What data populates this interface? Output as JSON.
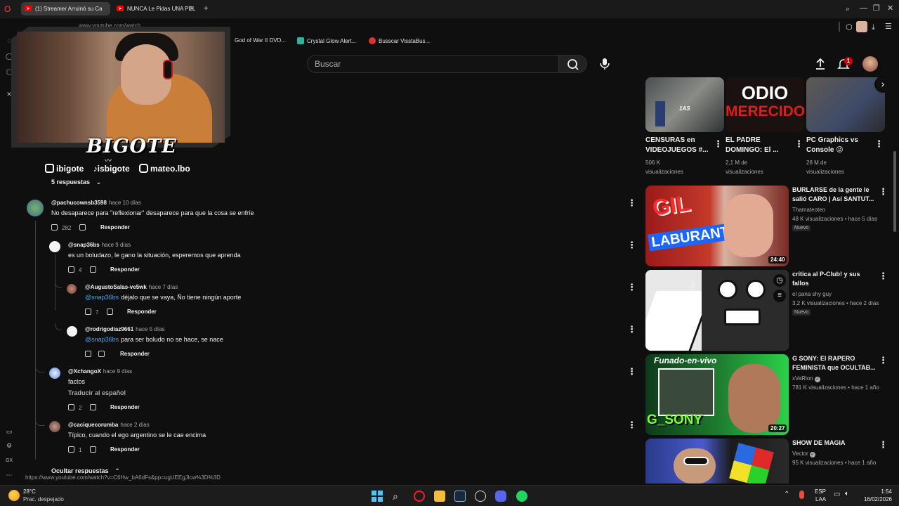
{
  "browser": {
    "tabs": [
      {
        "label": "(1) Streamer Arruinó su Ca",
        "active": true
      },
      {
        "label": "NUNCA Le Pidas UNA PEL",
        "active": false
      }
    ],
    "new_tab": "+",
    "address": "www.youtube.com/watch",
    "bookmarks": [
      {
        "label": "God of War II DVD...",
        "color": "#3a3a3a"
      },
      {
        "label": "Crystal Glow Alert...",
        "color": "#2bb3a3"
      },
      {
        "label": "Busscar VisstaBus...",
        "color": "#e03131"
      }
    ],
    "status_url": "https://www.youtube.com/watch?v=C6Hw_bA6dFs&pp=ugUEEgJlcw%3D%3D"
  },
  "youtube": {
    "search_placeholder": "Buscar",
    "notification_count": "1"
  },
  "overlay": {
    "brand": "BIGOTE",
    "socials": [
      {
        "icon": "twitch-kick-icon",
        "label": "ibigote"
      },
      {
        "icon": "tiktok-icon",
        "label": "isbigote"
      },
      {
        "icon": "instagram-icon",
        "label": "mateo.lbo"
      }
    ]
  },
  "comments": {
    "replies_toggle": "5 respuestas",
    "hide_replies": "Ocultar respuestas",
    "reply_label": "Responder",
    "translate_label": "Traducir al español",
    "items": [
      {
        "handle": "@pachucownsb3598",
        "time": "hace 10 días",
        "text": "No desaparece para \"reflexionar\" desaparece para que la cosa se enfríe",
        "likes": "282"
      },
      {
        "handle": "@snap36bs",
        "time": "hace 9 días",
        "text": "es un boludazo, le gano la situación, esperemos que aprenda",
        "likes": "4"
      },
      {
        "handle": "@AugustoSalas-ve5wk",
        "time": "hace 7 días",
        "mention": "@snap36bs",
        "text": "déjalo que se vaya, Ño tiene ningún aporte",
        "likes": "7"
      },
      {
        "handle": "@rodrigodiaz9661",
        "time": "hace 5 días",
        "mention": "@snap36bs",
        "text": "para ser boludo no se hace, se nace",
        "likes": ""
      },
      {
        "handle": "@XchangoX",
        "time": "hace 9 días",
        "text": "factos",
        "likes": "2"
      },
      {
        "handle": "@caciquecorumba",
        "time": "hace 2 días",
        "text": "Típico, cuando el ego argentino se le cae encima",
        "likes": "1"
      }
    ]
  },
  "shelf": [
    {
      "title1": "CENSURAS en",
      "title2": "VIDEOJUEGOS #...",
      "meta1": "506 K",
      "meta2": "visualizaciones"
    },
    {
      "title1": "EL PADRE",
      "title2": "DOMINGO: El ...",
      "meta1": "2,1 M de",
      "meta2": "visualizaciones",
      "thumb_text1": "ODIO",
      "thumb_text2": "MERECIDO"
    },
    {
      "title1": "PC Graphics vs",
      "title2": "Console 😜",
      "meta1": "28 M de",
      "meta2": "visualizaciones"
    }
  ],
  "shelf_thumb_label": "1AS",
  "videos": [
    {
      "title1": "BURLARSE de la gente le",
      "title2": "salió CARO | Así SANTUT...",
      "channel": "Thamateoteo",
      "views": "48 K visualizaciones",
      "age": "hace 5 días",
      "badge": "Nuevo",
      "duration": "24:40",
      "thumb_text1": "GIL",
      "thumb_text2": "LABURANTE!"
    },
    {
      "title1": "crítica al P-Club! y sus",
      "title2": "fallos",
      "channel": "el pana shy guy",
      "views": "3,2 K visualizaciones",
      "age": "hace 2 días",
      "badge": "Nuevo",
      "duration": ""
    },
    {
      "title1": "G SONY: El RAPERO",
      "title2": "FEMINISTA que OCULTAB...",
      "channel": "xVaRion",
      "views": "781 K visualizaciones",
      "age": "hace 1 año",
      "badge": "",
      "duration": "20:27",
      "thumb_text1": "Funado-en-vivo",
      "thumb_text2": "G_SONY"
    },
    {
      "title1": "SHOW DE MAGIA",
      "title2": "",
      "channel": "Vector",
      "views": "95 K visualizaciones",
      "age": "hace 1 año",
      "badge": "",
      "duration": ""
    }
  ],
  "taskbar": {
    "weather_temp": "28°C",
    "weather_desc": "Prac. despejado",
    "lang1": "ESP",
    "lang2": "LAA",
    "time": "1:54",
    "date": "16/02/2026"
  },
  "colors": {
    "accent": "#ff0000",
    "link": "#3ea6ff",
    "bg": "#0f0f0f"
  }
}
